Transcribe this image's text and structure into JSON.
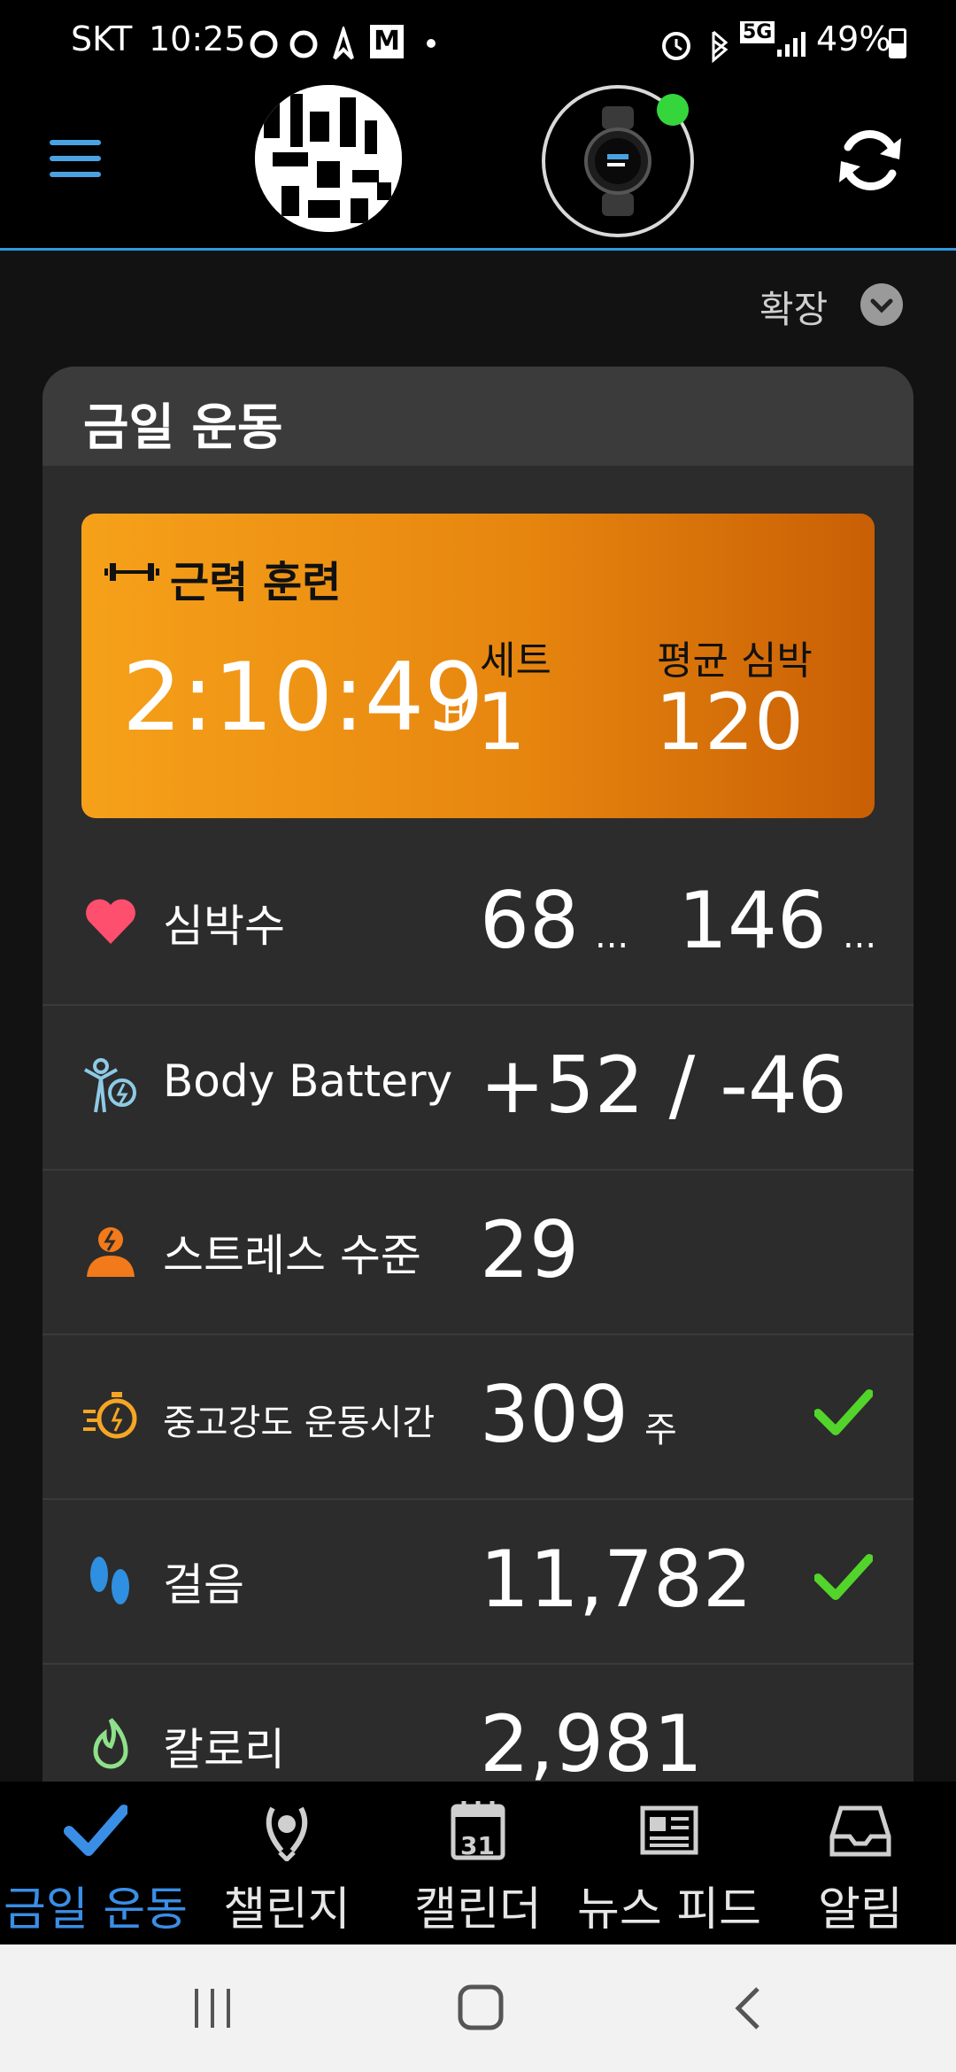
{
  "status_bar": {
    "carrier": "SKT",
    "time": "10:25",
    "mail_icon_letter": "M",
    "network": "5G",
    "battery": "49%"
  },
  "header": {
    "menu_icon": "hamburger-menu-icon",
    "avatar_icon": "avatar",
    "device_icon": "watch-icon",
    "sync_icon": "sync-icon"
  },
  "expand": {
    "label": "확장"
  },
  "today_card": {
    "title": "금일 운동",
    "activity": {
      "name": "근력 훈련",
      "duration": "2:10:49",
      "duration_unit": "H",
      "sets_label": "세트",
      "sets_value": "1",
      "avg_hr_label": "평균 심박",
      "avg_hr_value": "120"
    },
    "rows": [
      {
        "label": "심박수",
        "value": "68",
        "value_suffix": "...",
        "value2": "146",
        "value2_suffix": "...",
        "icon": "heart-icon",
        "color": "#ff4f6e"
      },
      {
        "label": "Body Battery",
        "value": "+52 / -46",
        "icon": "body-battery-icon",
        "color": "#8ecae6"
      },
      {
        "label": "스트레스 수준",
        "value": "29",
        "icon": "stress-icon",
        "color": "#f27a1a"
      },
      {
        "label": "중고강도 운동시간",
        "value": "309",
        "value_suffix": "주",
        "icon": "intensity-minutes-icon",
        "color": "#f5a623",
        "check": true
      },
      {
        "label": "걸음",
        "value": "11,782",
        "icon": "steps-icon",
        "color": "#2f8fe0",
        "check": true
      },
      {
        "label": "칼로리",
        "value": "2,981",
        "icon": "calories-icon",
        "color": "#8fe08a"
      }
    ]
  },
  "bottom_nav": [
    {
      "label": "금일 운동",
      "icon": "check-icon",
      "active": true
    },
    {
      "label": "챌린지",
      "icon": "laurel-icon",
      "active": false
    },
    {
      "label": "캘린더",
      "icon": "calendar-icon",
      "calendar_day": "31",
      "active": false
    },
    {
      "label": "뉴스 피드",
      "icon": "news-icon",
      "active": false
    },
    {
      "label": "알림",
      "icon": "inbox-icon",
      "active": false
    }
  ],
  "colors": {
    "accent": "#3a8ee6",
    "check": "#52d42a",
    "orange_start": "#f6a11a",
    "orange_end": "#c95f05"
  }
}
